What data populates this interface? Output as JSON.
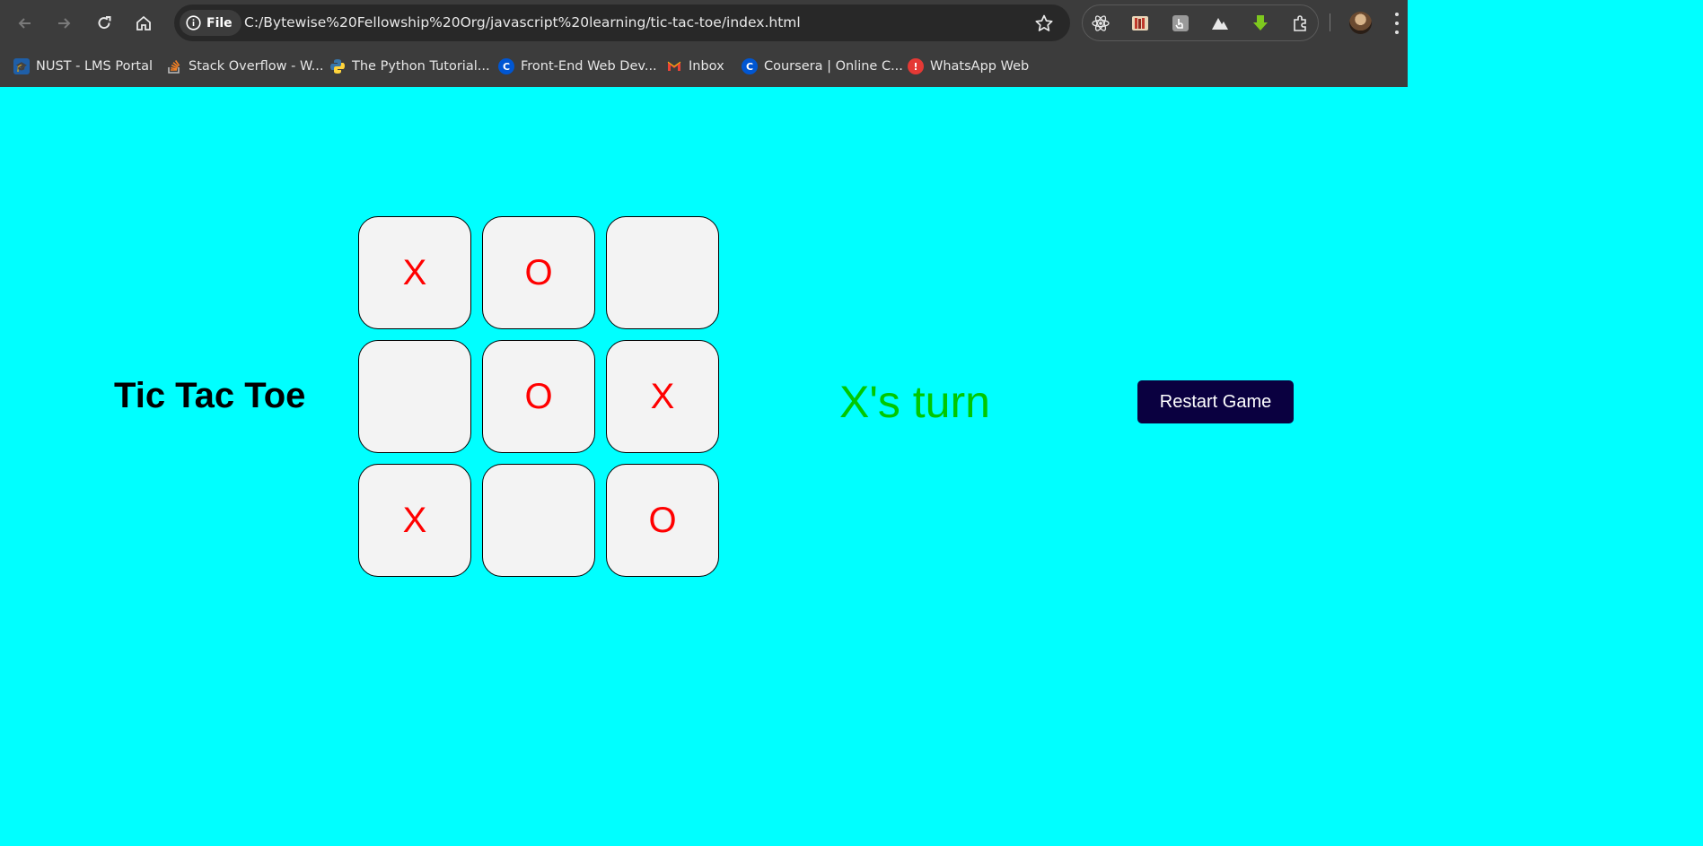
{
  "browser": {
    "file_label": "File",
    "url": "C:/Bytewise%20Fellowship%20Org/javascript%20learning/tic-tac-toe/index.html",
    "bookmarks": [
      {
        "label": "NUST - LMS Portal",
        "icon": "graduation-cap-icon",
        "color": "#1f5fa8"
      },
      {
        "label": "Stack Overflow - W...",
        "icon": "stackoverflow-icon",
        "color": "#f48024"
      },
      {
        "label": "The Python Tutorial...",
        "icon": "python-icon",
        "color": "#3776ab"
      },
      {
        "label": "Front-End Web Dev...",
        "icon": "coursera-icon",
        "color": "#0056d2"
      },
      {
        "label": "Inbox",
        "icon": "gmail-icon",
        "color": "#ea4335"
      },
      {
        "label": "Coursera | Online C...",
        "icon": "coursera-icon",
        "color": "#0056d2"
      },
      {
        "label": "WhatsApp Web",
        "icon": "whatsapp-icon",
        "color": "#e53935"
      }
    ]
  },
  "game": {
    "title": "Tic Tac Toe",
    "board": [
      "X",
      "O",
      "",
      "",
      "O",
      "X",
      "X",
      "",
      "O"
    ],
    "status": "X's turn",
    "restart_label": "Restart Game",
    "colors": {
      "background": "#00ffff",
      "mark": "#ff0000",
      "status": "#00c800",
      "button": "#0a0040"
    }
  }
}
